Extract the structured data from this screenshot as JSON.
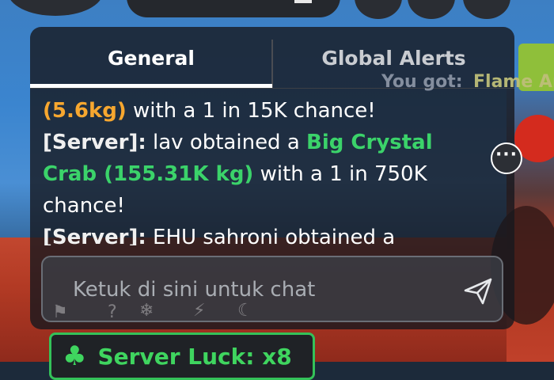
{
  "tabs": {
    "general": "General",
    "global_alerts": "Global Alerts"
  },
  "messages": {
    "m1_weight": "(5.6kg)",
    "m1_rest": " with a 1 in 15K chance!",
    "m2_prefix": "[Server]:",
    "m2_text": " lav obtained a ",
    "m2_item": "Big Crystal Crab (155.31K kg)",
    "m2_rest": " with a 1 in 750K chance!",
    "m3_prefix": "[Server]:",
    "m3_text": " EHU sahroni obtained a"
  },
  "overlay": {
    "you_got": "You got:",
    "item_partial": "Flame Ar"
  },
  "input": {
    "placeholder": "Ketuk di sini untuk chat"
  },
  "server_luck": {
    "label": "Server Luck: x8"
  },
  "icons": {
    "more": "ellipsis-icon",
    "send": "paper-plane-icon",
    "clover": "clover-icon"
  },
  "colors": {
    "rarity_orange": "#f7a72f",
    "rarity_green": "#3bd36a",
    "luck_green": "#3fd55f"
  }
}
